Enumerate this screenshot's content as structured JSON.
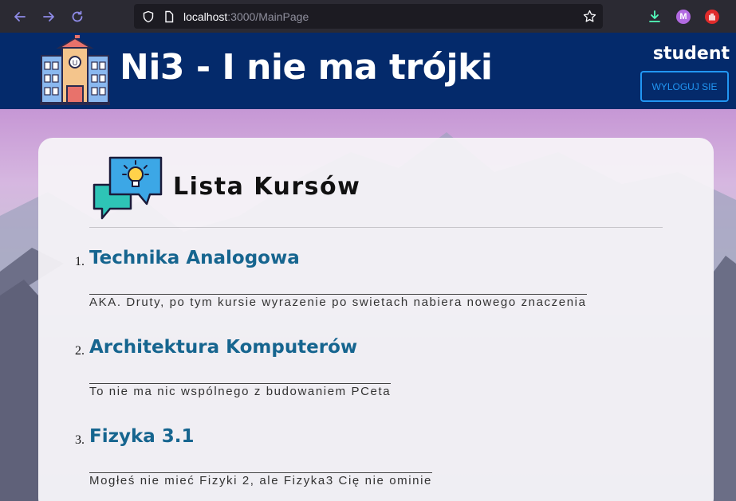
{
  "browser": {
    "url_host": "localhost",
    "url_path": ":3000/MainPage",
    "account_initial": "M"
  },
  "header": {
    "title": "Ni3 - I nie ma trójki",
    "user": "student",
    "logout_label": "WYLOGUJ SIE"
  },
  "courses_section": {
    "title": "Lista Kursów",
    "courses": [
      {
        "num": "1.",
        "title": "Technika Analogowa",
        "desc": "AKA. Druty, po tym kursie wyrazenie po swietach nabiera nowego znaczenia"
      },
      {
        "num": "2.",
        "title": "Architektura Komputerów",
        "desc": "To nie ma nic wspólnego z budowaniem PCeta"
      },
      {
        "num": "3.",
        "title": "Fizyka 3.1",
        "desc": "Mogłeś nie mieć Fizyki 2, ale Fizyka3 Cię nie ominie"
      }
    ]
  },
  "colors": {
    "header_bg": "#042a6b",
    "accent_blue": "#2196f3",
    "course_title": "#16658f"
  }
}
